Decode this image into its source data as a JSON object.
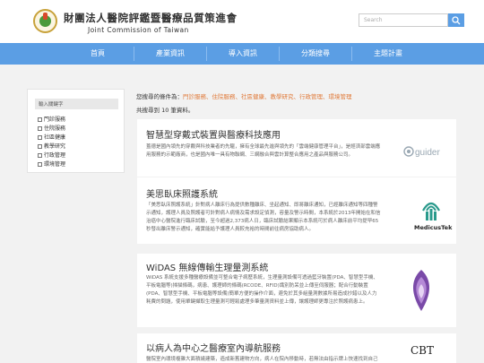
{
  "header": {
    "org_title": "財團法人醫院評鑑暨醫療品質策進會",
    "org_subtitle": "Joint Commission of Taiwan",
    "search_placeholder": "Search"
  },
  "nav": {
    "items": [
      {
        "label": "首頁"
      },
      {
        "label": "產業資訊"
      },
      {
        "label": "導入資訊"
      },
      {
        "label": "分類搜尋"
      },
      {
        "label": "主題計畫"
      }
    ]
  },
  "sidebar": {
    "keyword_placeholder": "輸入關鍵字",
    "items": [
      {
        "label": "門診服務"
      },
      {
        "label": "住院服務"
      },
      {
        "label": "社區健康"
      },
      {
        "label": "教學研究"
      },
      {
        "label": "行政管理"
      },
      {
        "label": "環境管理"
      }
    ]
  },
  "filter": {
    "prefix": "您搜尋的條件為：",
    "conditions": "門診服務、住院服務、社區健康、教學研究、行政管理、環境管理"
  },
  "results": {
    "count_text": "共搜尋到 10 筆資料。"
  },
  "cards": [
    {
      "title": "智慧型穿戴式裝置與醫療科技應用",
      "desc": "蓋德是國內領先的穿戴與科技業者的先驅，擁有全球最先進與領先的「雲端健康管理平台」，是經濟部雲端應用服務的示範廠商，也是國內唯一具有物聯網、三網融合與雲計算整合應用之產品與服務公司。",
      "logo_text": "guider"
    },
    {
      "title": "美思臥床照護系統",
      "desc": "「美思臥床照護系統」針對病人離床行為提供數種離床、坐起通知、即將離床通知，已經離床通知等四種警示通知，護理人員及照護者可針對病人病情及需求設定偵測，容量及警示時間，本系統於2013年開始在和信治癌中心醫院進行臨床試驗，至今超過2,373病人日，臨床試驗結果顯示本系統可於病人離床前平均提早65秒發出離床警示通知，確實能給予護理人員較充裕的時間前往病房協助病人。",
      "logo_text": "MedicusTek"
    },
    {
      "title": "WiDAS 無線傳輸生理量測系統",
      "desc": "WiDAS 系統支援多種醫療設備並可整合電子病歷系統，生理量測設備可透過藍牙裝置(PDA、智慧型手機、平板電腦等)掃描條碼，病患、護理師的條碼(RCODE、RFID)識別防呆並上傳至伺服器；配合行動裝置(PDA、智慧型手機、平板電腦等設備)簡單方便的操作介面，避免於其多組量測數據所易造成抄錯以及人力耗費的問題，使用單鍵擷取生理量測可輕鬆處理多筆量測資料並上傳，讓護理師更專注於照護病患上。"
    },
    {
      "title": "以病人為中心之醫療室內導航服務",
      "desc": "醫院室內環境複雜大面積繞建築，造成新舊建物方向，病人在院內移動時，若無法由指示牌上快速找到自己前往的科室，創新服務可以在室內環境中為病人進行導航。",
      "logo_text": "CBT"
    }
  ],
  "colors": {
    "nav_bg": "#5b9ee4",
    "page_bg": "#f2f2f2",
    "highlight": "#e07a3a"
  }
}
